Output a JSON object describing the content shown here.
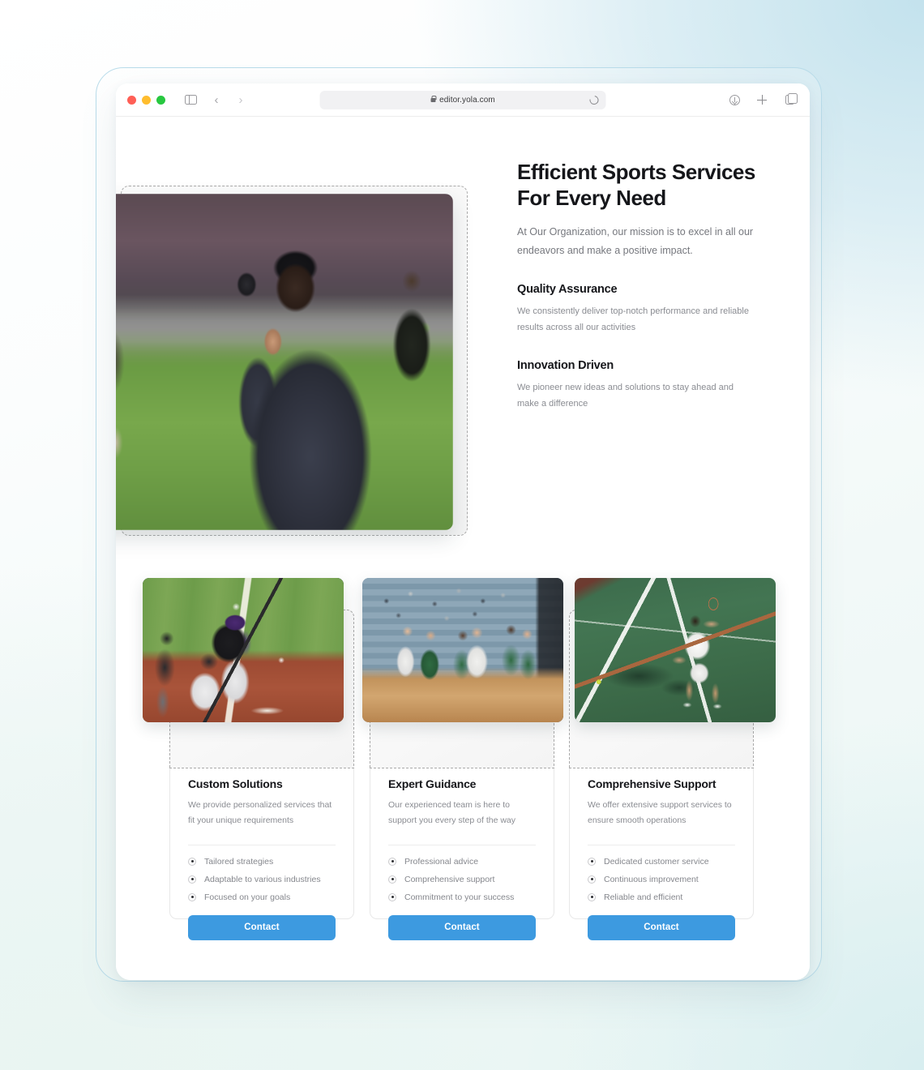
{
  "browser": {
    "url": "editor.yola.com",
    "traffic_lights": [
      "close-red",
      "minimize-yellow",
      "zoom-green"
    ],
    "icons": {
      "sidebar": "sidebar-toggle-icon",
      "back": "‹",
      "forward": "›",
      "shield": "privacy-shield-icon",
      "lock": "lock-icon",
      "reload": "reload-icon",
      "download": "download-icon",
      "new_tab": "plus-icon",
      "tab_overview": "tab-overview-icon"
    }
  },
  "hero": {
    "title": "Efficient Sports Services For Every Need",
    "subtitle": "At Our Organization, our mission is to excel in all our endeavors and make a positive impact.",
    "image_alt": "football-coach-with-headset",
    "features": [
      {
        "title": "Quality Assurance",
        "body": "We consistently deliver top-notch performance and reliable results across all our activities"
      },
      {
        "title": "Innovation Driven",
        "body": "We pioneer new ideas and solutions to stay ahead and make a difference"
      }
    ]
  },
  "cards": [
    {
      "image_alt": "baseball-batter-at-plate",
      "title": "Custom Solutions",
      "description": "We provide personalized services that fit your unique requirements",
      "bullets": [
        "Tailored strategies",
        "Adaptable to various industries",
        "Focused on your goals"
      ],
      "button": "Contact"
    },
    {
      "image_alt": "basketball-free-throw-lineup",
      "title": "Expert Guidance",
      "description": "Our experienced team is here to support you every step of the way",
      "bullets": [
        "Professional advice",
        "Comprehensive support",
        "Commitment to your success"
      ],
      "button": "Contact"
    },
    {
      "image_alt": "tennis-player-forehand",
      "title": "Comprehensive Support",
      "description": "We offer extensive support services to ensure smooth operations",
      "bullets": [
        "Dedicated customer service",
        "Continuous improvement",
        "Reliable and efficient"
      ],
      "button": "Contact"
    }
  ],
  "colors": {
    "accent_button": "#3d9ae0",
    "heading": "#15161a",
    "body_text": "#8a8c92",
    "frame_outline": "#b9dcea",
    "dropzone_dash": "#aaaaaa"
  }
}
